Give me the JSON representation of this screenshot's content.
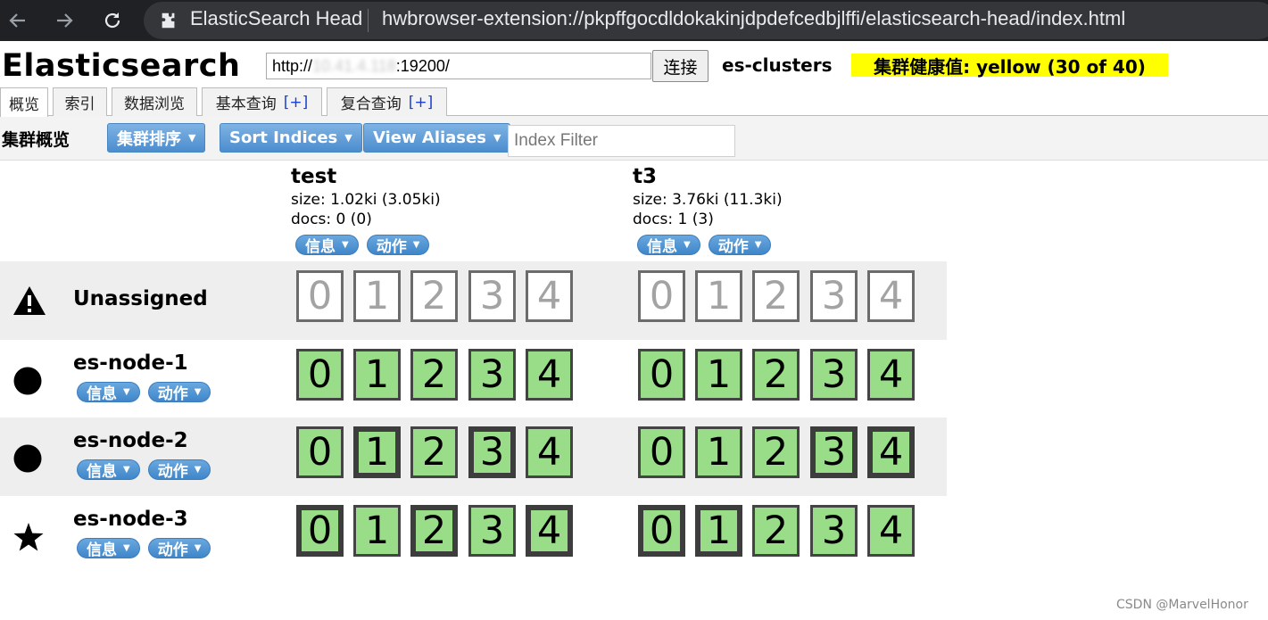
{
  "browser": {
    "page_title": "ElasticSearch Head",
    "url": "hwbrowser-extension://pkpffgocdldokakinjdpdefcedbjlffi/elasticsearch-head/index.html",
    "icons": [
      "back-icon",
      "forward-icon",
      "reload-icon",
      "extension-icon"
    ]
  },
  "header": {
    "app_title": "Elasticsearch",
    "connection": {
      "scheme": "http://",
      "host": "10.41.4.118",
      "port": ":19200/"
    },
    "connect_label": "连接",
    "cluster_name": "es-clusters",
    "health_text": "集群健康值: yellow (30 of 40)",
    "health_color": "#ffff00"
  },
  "tabs": [
    {
      "label": "概览",
      "plus": ""
    },
    {
      "label": "索引",
      "plus": ""
    },
    {
      "label": "数据浏览",
      "plus": ""
    },
    {
      "label": "基本查询",
      "plus": "[+]"
    },
    {
      "label": "复合查询",
      "plus": "[+]"
    }
  ],
  "toolbar": {
    "title": "集群概览",
    "sort_cluster_label": "集群排序",
    "sort_indices_label": "Sort Indices",
    "view_aliases_label": "View Aliases",
    "index_filter_placeholder": "Index Filter"
  },
  "pill_labels": {
    "info": "信息",
    "action": "动作"
  },
  "indices": [
    {
      "name": "test",
      "size": "size: 1.02ki (3.05ki)",
      "docs": "docs: 0 (0)"
    },
    {
      "name": "t3",
      "size": "size: 3.76ki (11.3ki)",
      "docs": "docs: 1 (3)"
    }
  ],
  "rows": [
    {
      "name": "Unassigned",
      "icon": "warning-icon",
      "has_buttons": false,
      "shards": [
        [
          "un",
          "un",
          "un",
          "un",
          "un"
        ],
        [
          "un",
          "un",
          "un",
          "un",
          "un"
        ]
      ]
    },
    {
      "name": "es-node-1",
      "icon": "node-circle-icon",
      "has_buttons": true,
      "shards": [
        [
          "rep",
          "rep",
          "rep",
          "rep",
          "rep"
        ],
        [
          "rep",
          "rep",
          "rep",
          "rep",
          "rep"
        ]
      ]
    },
    {
      "name": "es-node-2",
      "icon": "node-circle-icon",
      "has_buttons": true,
      "shards": [
        [
          "rep",
          "pri",
          "rep",
          "pri",
          "rep"
        ],
        [
          "rep",
          "rep",
          "rep",
          "pri",
          "pri"
        ]
      ]
    },
    {
      "name": "es-node-3",
      "icon": "master-star-icon",
      "has_buttons": true,
      "shards": [
        [
          "pri",
          "rep",
          "pri",
          "rep",
          "pri"
        ],
        [
          "pri",
          "pri",
          "rep",
          "rep",
          "rep"
        ]
      ]
    }
  ],
  "shard_numbers": [
    "0",
    "1",
    "2",
    "3",
    "4"
  ],
  "colors": {
    "shard_green": "#99dd88",
    "button_blue": "#4b8dcf"
  },
  "watermark": "CSDN @MarvelHonor"
}
